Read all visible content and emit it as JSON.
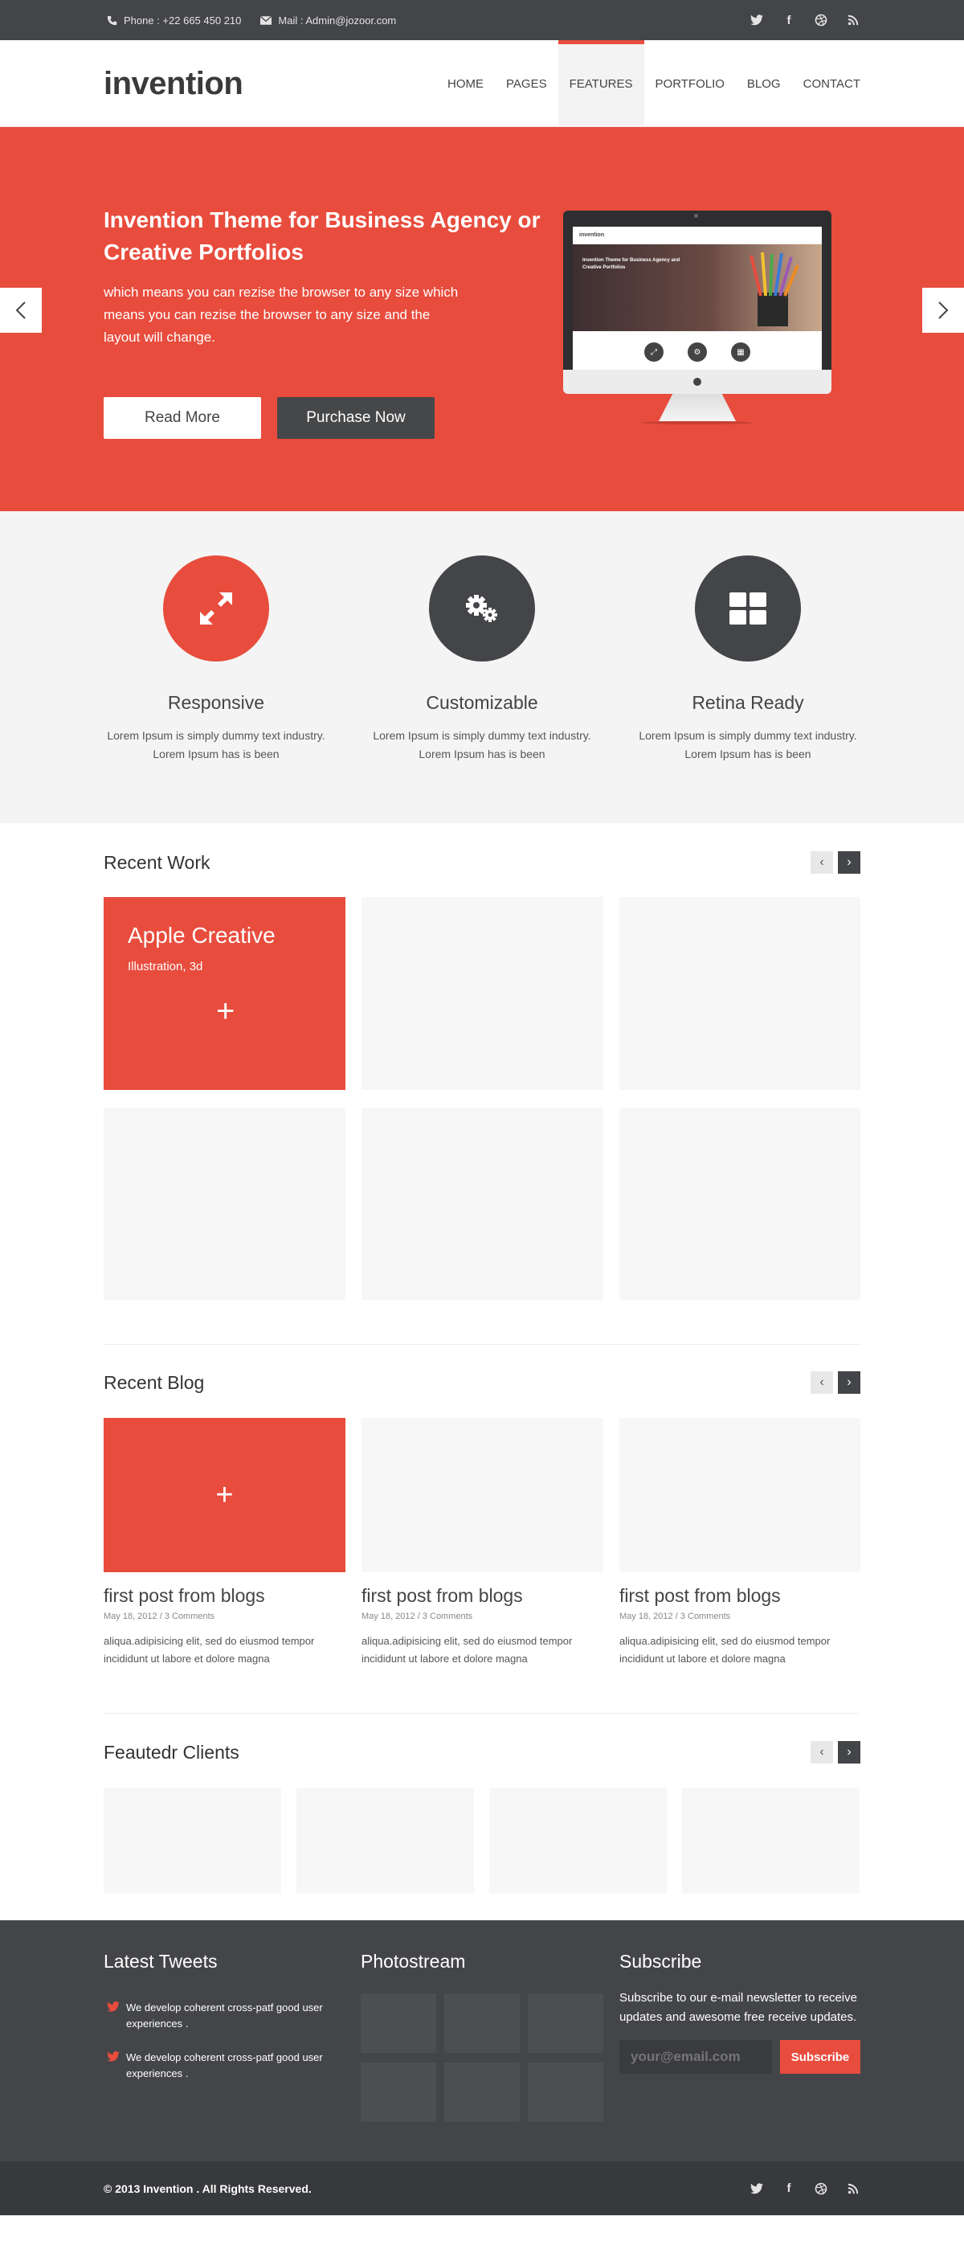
{
  "topbar": {
    "phone": "Phone : +22 665 450 210",
    "mail": "Mail : Admin@jozoor.com",
    "social": [
      "twitter-icon",
      "facebook-icon",
      "dribbble-icon",
      "rss-icon"
    ]
  },
  "header": {
    "logo": "invention",
    "nav": [
      "HOME",
      "PAGES",
      "FEATURES",
      "PORTFOLIO",
      "BLOG",
      "CONTACT"
    ],
    "active_nav": "FEATURES"
  },
  "hero": {
    "title": "Invention Theme for Business Agency or Creative Portfolios",
    "text": "which means you can rezise the browser to any size which means you can rezise the browser to any size and the layout will change.",
    "read_more": "Read More",
    "purchase": "Purchase Now",
    "mockup": {
      "logo": "invention",
      "title": "Invention Theme for Business Agency and Creative Portfolios"
    }
  },
  "features": [
    {
      "title": "Responsive",
      "text": "Lorem Ipsum is simply dummy text industry. Lorem Ipsum has is been",
      "icon": "expand-arrows-icon"
    },
    {
      "title": "Customizable",
      "text": "Lorem Ipsum is simply dummy text industry. Lorem Ipsum has is been",
      "icon": "gears-icon"
    },
    {
      "title": "Retina Ready",
      "text": "Lorem Ipsum is simply dummy text industry. Lorem Ipsum has is been",
      "icon": "grid-icon"
    }
  ],
  "recent_work": {
    "heading": "Recent Work",
    "featured": {
      "title": "Apple Creative",
      "subtitle": "Illustration, 3d"
    }
  },
  "recent_blog": {
    "heading": "Recent Blog",
    "posts": [
      {
        "title": "first post from blogs",
        "meta": "May 18, 2012 / 3 Comments",
        "text": "aliqua.adipisicing elit, sed do eiusmod tempor incididunt ut labore et dolore magna"
      },
      {
        "title": "first post from blogs",
        "meta": "May 18, 2012 / 3 Comments",
        "text": "aliqua.adipisicing elit, sed do eiusmod tempor incididunt ut labore et dolore magna"
      },
      {
        "title": "first post from blogs",
        "meta": "May 18, 2012 / 3 Comments",
        "text": "aliqua.adipisicing elit, sed do eiusmod tempor incididunt ut labore et dolore magna"
      }
    ]
  },
  "clients": {
    "heading": "Feautedr Clients"
  },
  "footer": {
    "tweets_heading": "Latest Tweets",
    "tweets": [
      "We develop coherent cross-patf good user experiences .",
      "We develop coherent cross-patf good user experiences ."
    ],
    "photostream_heading": "Photostream",
    "subscribe_heading": "Subscribe",
    "subscribe_text": "Subscribe to our e-mail newsletter to receive updates and awesome free receive updates.",
    "email_placeholder": "your@email.com",
    "subscribe_button": "Subscribe",
    "copyright": "© 2013 Invention . All Rights Reserved."
  },
  "colors": {
    "accent": "#e84c3d",
    "dark": "#444548",
    "light_bg": "#f4f4f4"
  }
}
